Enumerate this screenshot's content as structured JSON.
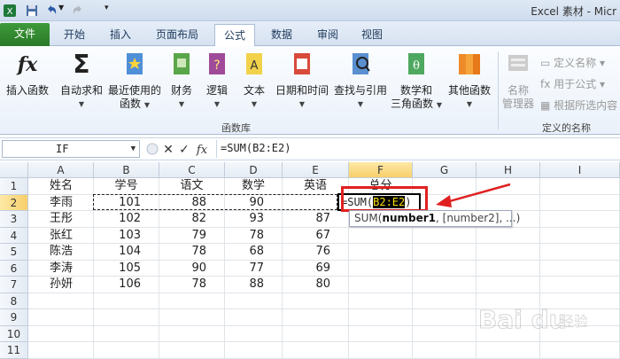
{
  "window": {
    "title": "Excel 素材 - Micr"
  },
  "tabs": [
    {
      "label": "文件"
    },
    {
      "label": "开始"
    },
    {
      "label": "插入"
    },
    {
      "label": "页面布局"
    },
    {
      "label": "公式"
    },
    {
      "label": "数据"
    },
    {
      "label": "审阅"
    },
    {
      "label": "视图"
    }
  ],
  "ribbon": {
    "insert_function": "插入函数",
    "autosum": "自动求和",
    "recent_line1": "最近使用的",
    "recent_line2": "函数",
    "financial": "财务",
    "logical": "逻辑",
    "text": "文本",
    "datetime": "日期和时间",
    "lookup": "查找与引用",
    "math_line1": "数学和",
    "math_line2": "三角函数",
    "other": "其他函数",
    "function_library": "函数库",
    "name_manager_line1": "名称",
    "name_manager_line2": "管理器",
    "define_name": "定义名称",
    "use_in_formula": "用于公式",
    "create_from_selection": "根据所选内容",
    "defined_names": "定义的名称"
  },
  "formula_bar": {
    "name_box": "IF",
    "formula": "=SUM(B2:E2)"
  },
  "columns": [
    "A",
    "B",
    "C",
    "D",
    "E",
    "F",
    "G",
    "H",
    "I"
  ],
  "rows": [
    "1",
    "2",
    "3",
    "4",
    "5",
    "6",
    "7",
    "8",
    "9",
    "10",
    "11"
  ],
  "headers": {
    "name": "姓名",
    "id": "学号",
    "chinese": "语文",
    "math": "数学",
    "english": "英语",
    "total": "总分"
  },
  "students": [
    {
      "name": "李雨",
      "id": "101",
      "chinese": "88",
      "math": "90",
      "english": ""
    },
    {
      "name": "王彤",
      "id": "102",
      "chinese": "82",
      "math": "93",
      "english": "87"
    },
    {
      "name": "张红",
      "id": "103",
      "chinese": "79",
      "math": "78",
      "english": "67"
    },
    {
      "name": "陈浩",
      "id": "104",
      "chinese": "78",
      "math": "68",
      "english": "76"
    },
    {
      "name": "李涛",
      "id": "105",
      "chinese": "90",
      "math": "77",
      "english": "69"
    },
    {
      "name": "孙妍",
      "id": "106",
      "chinese": "78",
      "math": "88",
      "english": "80"
    }
  ],
  "active_cell": {
    "prefix": "=SUM(",
    "range": "B2:E2",
    "suffix": ")"
  },
  "tooltip": {
    "func": "SUM(",
    "arg1": "number1",
    "rest": ", [number2], ...)"
  },
  "colors": {
    "file_tab": "#2a7a28",
    "highlight": "#e02020",
    "selected_header": "#f8cf6a"
  },
  "watermark": {
    "text": "Baidu 经验"
  }
}
